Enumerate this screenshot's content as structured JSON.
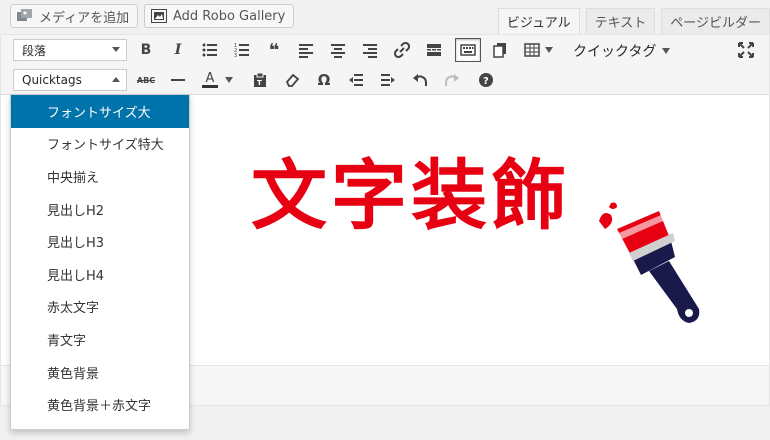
{
  "media_buttons": {
    "add_media": "メディアを追加",
    "add_gallery": "Add Robo Gallery"
  },
  "tabs": [
    "ビジュアル",
    "テキスト",
    "ページビルダー"
  ],
  "toolbar": {
    "format_select": "段落",
    "quicktags_select": "Quicktags",
    "quicktag_menu_label": "クイックタグ",
    "row1_icons": [
      "bold-icon",
      "italic-icon",
      "bullet-list-icon",
      "numbered-list-icon",
      "blockquote-icon",
      "align-left-icon",
      "align-center-icon",
      "align-right-icon",
      "link-icon",
      "read-more-icon",
      "keyboard-icon",
      "copy-icon",
      "table-icon"
    ],
    "row2_icons": [
      "strikethrough-icon",
      "horizontal-line-icon",
      "text-color-icon",
      "paste-text-icon",
      "clear-formatting-icon",
      "special-char-icon",
      "outdent-icon",
      "indent-icon",
      "undo-icon",
      "redo-icon",
      "help-icon"
    ]
  },
  "content": {
    "headline": "文字装飾",
    "accent_color": "#e60012"
  },
  "quicktags_menu": [
    "フォントサイズ大",
    "フォントサイズ特大",
    "中央揃え",
    "見出しH2",
    "見出しH3",
    "見出しH4",
    "赤太文字",
    "青文字",
    "黄色背景",
    "黄色背景＋赤文字"
  ],
  "colors": {
    "menu_highlight": "#0073aa"
  }
}
